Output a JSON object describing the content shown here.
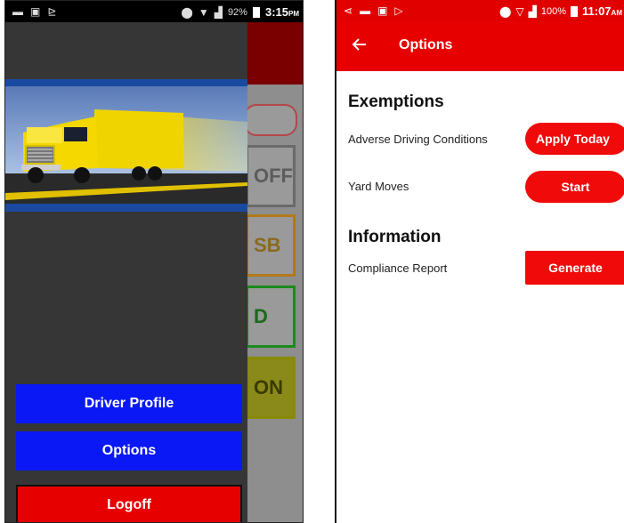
{
  "left_screen": {
    "status_bar": {
      "battery": "92%",
      "time": "3:15",
      "time_suffix": "PM",
      "icons": [
        "voicemail-icon",
        "image-icon",
        "cast-icon",
        "location-icon",
        "wifi-icon",
        "signal-icon",
        "battery-icon"
      ]
    },
    "background_app": {
      "status_tiles": [
        "OFF",
        "SB",
        "D",
        "ON"
      ],
      "tile_colors": [
        "#6a6a6a",
        "#b07a1a",
        "#1c8a1c",
        "#8a8a00"
      ]
    },
    "drawer": {
      "banner_icon": "truck-image",
      "items": [
        {
          "label": "Driver Profile",
          "color": "#0a18f5"
        },
        {
          "label": "Options",
          "color": "#0a18f5"
        },
        {
          "label": "Logoff",
          "color": "#e60000"
        }
      ]
    }
  },
  "right_screen": {
    "status_bar": {
      "battery": "100%",
      "time": "11:07",
      "time_suffix": "AM"
    },
    "app_bar": {
      "title": "Options",
      "back_icon": "arrow-left-icon",
      "color": "#e60000"
    },
    "sections": [
      {
        "title": "Exemptions",
        "rows": [
          {
            "label": "Adverse Driving Conditions",
            "button": "Apply Today"
          },
          {
            "label": "Yard Moves",
            "button": "Start"
          }
        ]
      },
      {
        "title": "Information",
        "rows": [
          {
            "label": "Compliance Report",
            "button": "Generate"
          }
        ]
      }
    ]
  }
}
